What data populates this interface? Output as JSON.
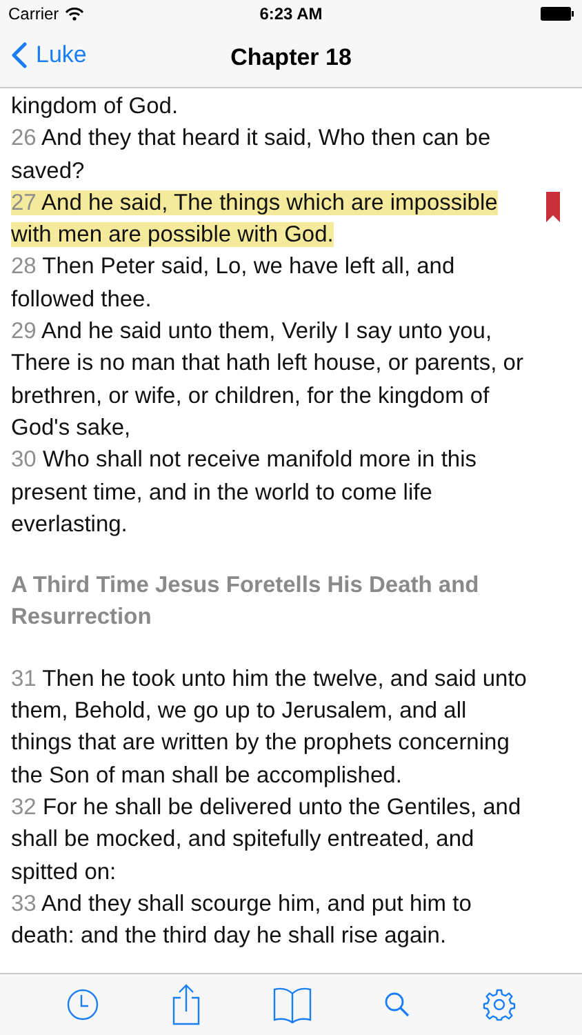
{
  "status_bar": {
    "carrier": "Carrier",
    "time": "6:23 AM"
  },
  "nav": {
    "back": "Luke",
    "title": "Chapter 18"
  },
  "passage": [
    {
      "kind": "text",
      "text": "kingdom of God."
    },
    {
      "kind": "verse",
      "number": "26",
      "text": "And they that heard it said, Who then can be saved?",
      "highlighted": false,
      "bookmarked": false
    },
    {
      "kind": "verse",
      "number": "27",
      "text": "And he said, The things which are impossible with men are possible with God.",
      "highlighted": true,
      "bookmarked": true
    },
    {
      "kind": "verse",
      "number": "28",
      "text": "Then Peter said, Lo, we have left all, and followed thee.",
      "highlighted": false,
      "bookmarked": false
    },
    {
      "kind": "verse",
      "number": "29",
      "text": "And he said unto them, Verily I say unto you, There is no man that hath left house, or parents, or brethren, or wife, or children, for the kingdom of God's sake,",
      "highlighted": false,
      "bookmarked": false
    },
    {
      "kind": "verse",
      "number": "30",
      "text": "Who shall not receive manifold more in this present time, and in the world to come life everlasting.",
      "highlighted": false,
      "bookmarked": false
    },
    {
      "kind": "heading",
      "text": "A Third Time Jesus Foretells His Death and Resurrection"
    },
    {
      "kind": "verse",
      "number": "31",
      "text": "Then he took unto him the twelve, and said unto them, Behold, we go up to Jerusalem, and all things that are written by the prophets concerning the Son of man shall be accomplished.",
      "highlighted": false,
      "bookmarked": false
    },
    {
      "kind": "verse",
      "number": "32",
      "text": "For he shall be delivered unto the Gentiles, and shall be mocked, and spitefully entreated, and spitted on:",
      "highlighted": false,
      "bookmarked": false
    },
    {
      "kind": "verse",
      "number": "33",
      "text": "And they shall scourge him, and put him to death: and the third day he shall rise again.",
      "highlighted": false,
      "bookmarked": false
    }
  ]
}
